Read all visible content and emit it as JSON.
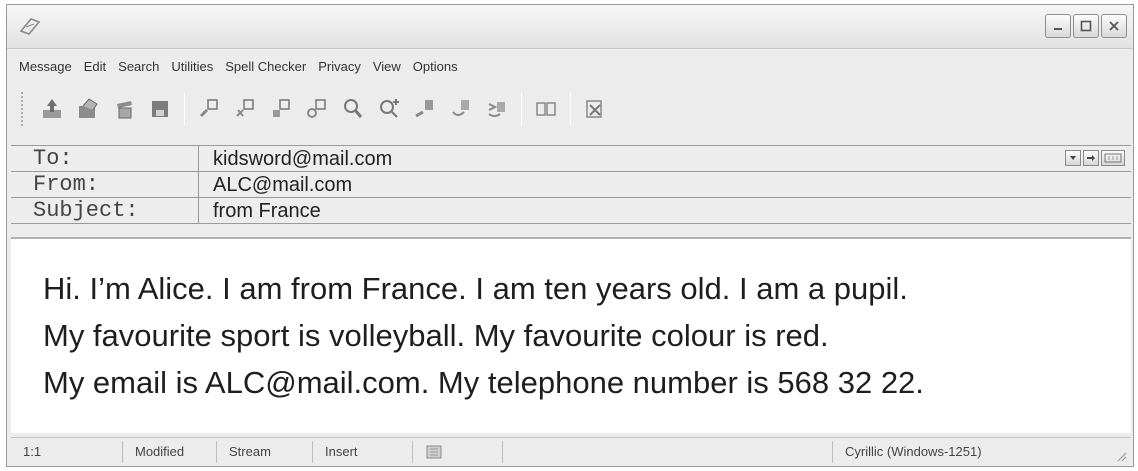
{
  "window": {
    "title": ""
  },
  "menu": {
    "items": [
      "Message",
      "Edit",
      "Search",
      "Utilities",
      "Spell Checker",
      "Privacy",
      "View",
      "Options"
    ]
  },
  "toolbar": {
    "buttons": [
      "send-icon",
      "attach-icon",
      "bin-icon",
      "save-icon",
      "copy-icon",
      "cut-icon",
      "paste-icon",
      "find-icon",
      "zoom-icon",
      "zoom-plus-icon",
      "import-icon",
      "import-alt-icon",
      "export-icon",
      "template-icon",
      "sign-icon"
    ]
  },
  "headers": {
    "to_label": "To:",
    "to_value": "kidsword@mail.com",
    "from_label": "From:",
    "from_value": "ALC@mail.com",
    "subject_label": "Subject:",
    "subject_value": "from France"
  },
  "body": {
    "lines": [
      "Hi. I’m Alice. I am from France. I am ten years old. I am a pupil.",
      "My favourite sport is volleyball. My favourite colour is red.",
      "My email is ALC@mail.com. My telephone number  is 568 32 22."
    ]
  },
  "status": {
    "position": "1:1",
    "modified": "Modified",
    "mode": "Stream",
    "insert": "Insert",
    "charset": "Cyrillic (Windows-1251)"
  }
}
